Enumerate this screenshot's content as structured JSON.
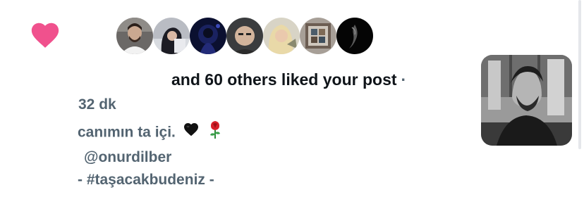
{
  "notification": {
    "icon": "heart-icon",
    "heart_color": "#f0518d",
    "liked_text": "and 60 others liked your post",
    "separator": "·",
    "time": "32 dk",
    "caption": "canımın ta içi.",
    "caption_emojis": [
      "black-heart-emoji",
      "rose-emoji"
    ],
    "mention": "@onurdilber",
    "hashtag_line": "- #taşacakbudeniz -",
    "avatar_count": 7
  }
}
